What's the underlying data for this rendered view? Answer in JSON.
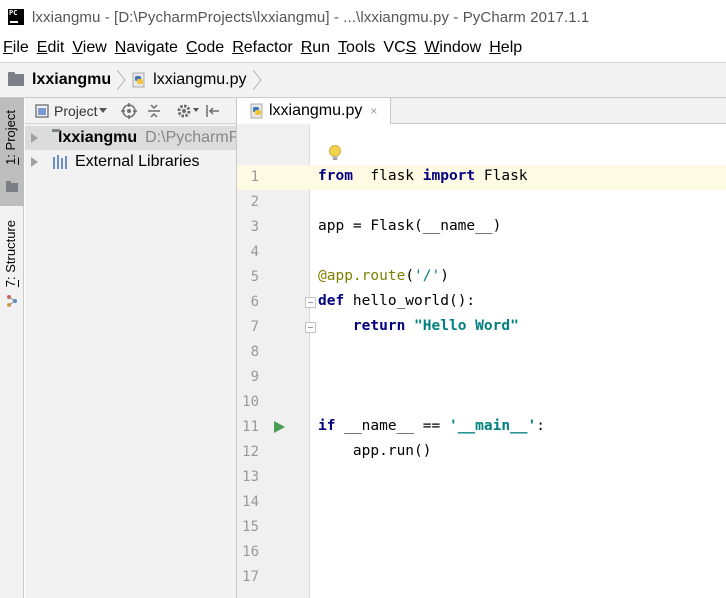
{
  "window": {
    "title": "lxxiangmu - [D:\\PycharmProjects\\lxxiangmu] - ...\\lxxiangmu.py - PyCharm 2017.1.1",
    "app_icon": "pycharm-logo-icon",
    "app_icon_text": "PC"
  },
  "menu": [
    {
      "u": "F",
      "rest": "ile"
    },
    {
      "u": "E",
      "rest": "dit"
    },
    {
      "u": "V",
      "rest": "iew"
    },
    {
      "u": "N",
      "rest": "avigate"
    },
    {
      "u": "C",
      "rest": "ode"
    },
    {
      "u": "R",
      "rest": "efactor"
    },
    {
      "u": "R",
      "rest": "un"
    },
    {
      "u": "T",
      "rest": "ools"
    },
    {
      "pre": "VC",
      "u": "S",
      "rest": ""
    },
    {
      "u": "W",
      "rest": "indow"
    },
    {
      "u": "H",
      "rest": "elp"
    }
  ],
  "breadcrumb": {
    "project": "lxxiangmu",
    "file": "lxxiangmu.py"
  },
  "toolstrip": {
    "project_tab": {
      "mnemonic": "1",
      "label": ": Project"
    },
    "structure_tab": {
      "mnemonic": "7",
      "label": ": Structure"
    }
  },
  "project_panel": {
    "view_label": "Project",
    "tree": {
      "root_name": "lxxiangmu",
      "root_path": "D:\\PycharmProjects\\lxxiangmu",
      "external": "External Libraries"
    }
  },
  "editor": {
    "tab_label": "lxxiangmu.py",
    "close_glyph": "×",
    "current_line": 1,
    "lines": [
      {
        "n": "1",
        "parts": [
          [
            "kw",
            "from"
          ],
          [
            "",
            "  flask "
          ],
          [
            "kw",
            "import"
          ],
          [
            "",
            " Flask"
          ]
        ]
      },
      {
        "n": "2",
        "parts": []
      },
      {
        "n": "3",
        "parts": [
          [
            "",
            "app = Flask(__name__)"
          ]
        ]
      },
      {
        "n": "4",
        "parts": []
      },
      {
        "n": "5",
        "parts": [
          [
            "dec",
            "@app.route"
          ],
          [
            "",
            "("
          ],
          [
            "str-plain",
            "'/'"
          ],
          [
            "",
            ")"
          ]
        ]
      },
      {
        "n": "6",
        "parts": [
          [
            "kw",
            "def"
          ],
          [
            "",
            " hello_world():"
          ]
        ]
      },
      {
        "n": "7",
        "parts": [
          [
            "",
            "    "
          ],
          [
            "kw",
            "return"
          ],
          [
            "",
            " "
          ],
          [
            "str",
            "\"Hello Word\""
          ]
        ]
      },
      {
        "n": "8",
        "parts": []
      },
      {
        "n": "9",
        "parts": []
      },
      {
        "n": "10",
        "parts": []
      },
      {
        "n": "11",
        "parts": [
          [
            "kw",
            "if"
          ],
          [
            "",
            " __name__ == "
          ],
          [
            "str",
            "'__main__'"
          ],
          [
            "",
            ":"
          ]
        ]
      },
      {
        "n": "12",
        "parts": [
          [
            "",
            "    app.run()"
          ]
        ]
      },
      {
        "n": "13",
        "parts": []
      },
      {
        "n": "14",
        "parts": []
      },
      {
        "n": "15",
        "parts": []
      },
      {
        "n": "16",
        "parts": []
      },
      {
        "n": "17",
        "parts": []
      }
    ]
  },
  "colors": {
    "keyword": "#000080",
    "string": "#008080",
    "decorator": "#808000",
    "current_line": "#fffae3",
    "run_gutter": "#499c54"
  }
}
